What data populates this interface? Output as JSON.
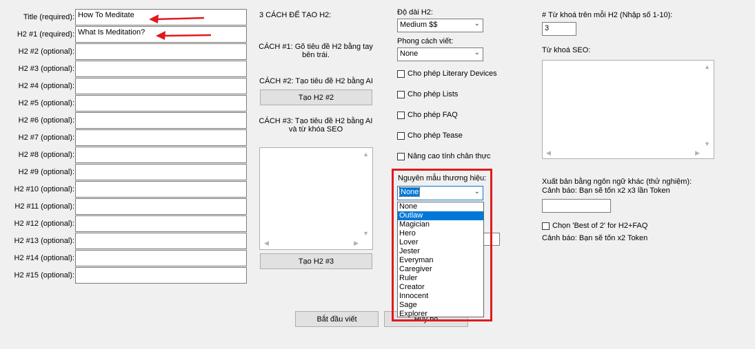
{
  "left": {
    "rows": [
      {
        "label": "Title (required):",
        "value": "How To Meditate"
      },
      {
        "label": "H2 #1 (required):",
        "value": "What Is Meditation?"
      },
      {
        "label": "H2 #2 (optional):",
        "value": ""
      },
      {
        "label": "H2 #3 (optional):",
        "value": ""
      },
      {
        "label": "H2 #4 (optional):",
        "value": ""
      },
      {
        "label": "H2 #5 (optional):",
        "value": ""
      },
      {
        "label": "H2 #6 (optional):",
        "value": ""
      },
      {
        "label": "H2 #7 (optional):",
        "value": ""
      },
      {
        "label": "H2 #8 (optional):",
        "value": ""
      },
      {
        "label": "H2 #9 (optional):",
        "value": ""
      },
      {
        "label": "H2 #10 (optional):",
        "value": ""
      },
      {
        "label": "H2 #11 (optional):",
        "value": ""
      },
      {
        "label": "H2 #12 (optional):",
        "value": ""
      },
      {
        "label": "H2 #13 (optional):",
        "value": ""
      },
      {
        "label": "H2 #14 (optional):",
        "value": ""
      },
      {
        "label": "H2 #15 (optional):",
        "value": ""
      }
    ]
  },
  "middle": {
    "heading": "3 CÁCH ĐỂ TẠO H2:",
    "way1": "CÁCH #1: Gõ tiêu đề H2 bằng tay bên trái.",
    "way2": "CÁCH #2: Tạo tiêu đề H2 bằng AI",
    "btn_h2_2": "Tạo H2 #2",
    "way3": "CÁCH #3: Tạo tiêu đề H2 bằng AI và từ khóa SEO",
    "btn_h2_3": "Tạo H2 #3"
  },
  "options": {
    "length_label": "Độ dài H2:",
    "length_value": "Medium $$",
    "style_label": "Phong cách viết:",
    "style_value": "None",
    "checkboxes": [
      "Cho phép Literary Devices",
      "Cho phép Lists",
      "Cho phép FAQ",
      "Cho phép Tease",
      "Nâng cao tính chân thực"
    ],
    "archetype_label": "Nguyên mẫu thương hiệu:",
    "archetype_value": "None",
    "archetype_options": [
      "None",
      "Outlaw",
      "Magician",
      "Hero",
      "Lover",
      "Jester",
      "Everyman",
      "Caregiver",
      "Ruler",
      "Creator",
      "Innocent",
      "Sage",
      "Explorer"
    ],
    "highlighted_option": "Outlaw"
  },
  "right": {
    "kw_count_label": "# Từ khoá trên mỗi H2 (Nhập số 1-10):",
    "kw_count_value": "3",
    "seo_label": "Từ khoá SEO:",
    "lang_label": "Xuất bản bằng ngôn ngữ khác (thử nghiệm):",
    "lang_warning": "Cảnh báo: Bạn sẽ tốn x2 x3 lần Token",
    "best_of_label": "Chọn 'Best of 2' for H2+FAQ",
    "best_of_warning": "Cảnh báo: Bạn sẽ tốn x2 Token"
  },
  "bottom": {
    "start_button": "Bắt đầu viết",
    "cancel_button": "Hủy bỏ"
  },
  "colors": {
    "annotation_arrow": "#e0191f",
    "highlight_box": "#e0191f",
    "selection": "#0078d7"
  }
}
